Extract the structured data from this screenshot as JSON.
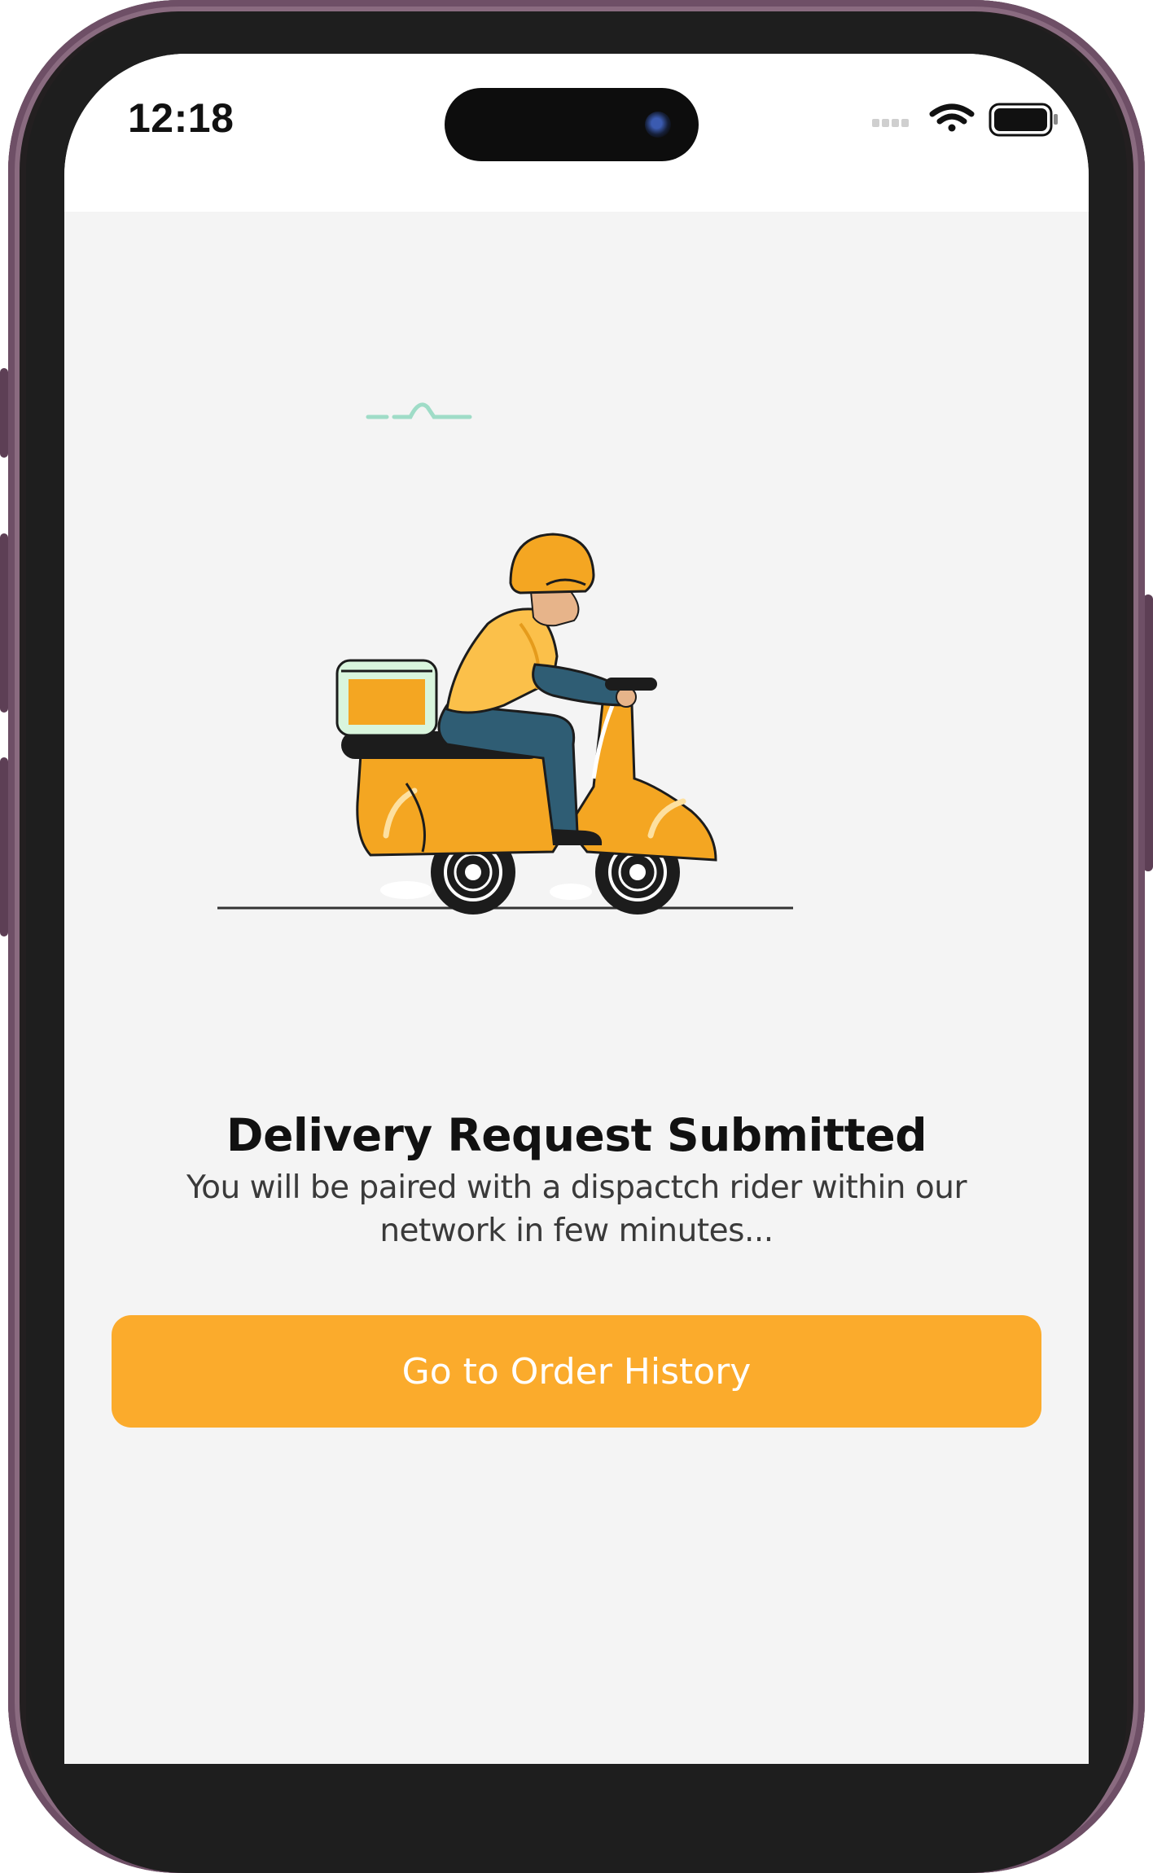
{
  "status_bar": {
    "time": "12:18",
    "icons": [
      "signal-icon",
      "wifi-icon",
      "battery-icon"
    ]
  },
  "illustration": {
    "name": "delivery-scooter-illustration",
    "colors": {
      "scooter": "#f4a622",
      "helmet": "#f4a622",
      "shirt": "#fbc04a",
      "trousers": "#2f5d74",
      "box_lid": "#d9f5dd",
      "accent_line": "#9fdcc7"
    }
  },
  "main": {
    "title": "Delivery Request Submitted",
    "subtitle": "You will be paired with a dispactch rider within our network in few minutes..."
  },
  "actions": {
    "primary_label": "Go to Order History"
  },
  "colors": {
    "accent": "#fbab2c",
    "background": "#f4f4f4",
    "frame": "#6e4f66"
  }
}
